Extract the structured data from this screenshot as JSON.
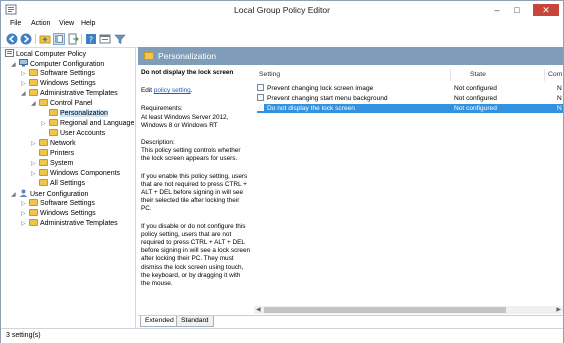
{
  "window": {
    "title": "Local Group Policy Editor",
    "controls": [
      "–",
      "□",
      "✕"
    ]
  },
  "menu": [
    "File",
    "Action",
    "View",
    "Help"
  ],
  "toolbar": [
    "back-icon",
    "forward-icon",
    "up-folder-icon",
    "show-hide-tree-icon",
    "export-list-icon",
    "help-icon",
    "properties-icon",
    "filter-icon"
  ],
  "tree": [
    {
      "label": "Local Computer Policy",
      "level": 0,
      "arrow": "",
      "icon": "computer-policy"
    },
    {
      "label": "Computer Configuration",
      "level": 1,
      "arrow": "◢",
      "icon": "computer"
    },
    {
      "label": "Software Settings",
      "level": 2,
      "arrow": "▷",
      "icon": "folder"
    },
    {
      "label": "Windows Settings",
      "level": 2,
      "arrow": "▷",
      "icon": "folder"
    },
    {
      "label": "Administrative Templates",
      "level": 2,
      "arrow": "◢",
      "icon": "folder"
    },
    {
      "label": "Control Panel",
      "level": 3,
      "arrow": "◢",
      "icon": "folder"
    },
    {
      "label": "Personalization",
      "level": 4,
      "arrow": "",
      "icon": "folder",
      "selected": true
    },
    {
      "label": "Regional and Language",
      "level": 4,
      "arrow": "▷",
      "icon": "folder"
    },
    {
      "label": "User Accounts",
      "level": 4,
      "arrow": "",
      "icon": "folder"
    },
    {
      "label": "Network",
      "level": 3,
      "arrow": "▷",
      "icon": "folder"
    },
    {
      "label": "Printers",
      "level": 3,
      "arrow": "",
      "icon": "folder"
    },
    {
      "label": "System",
      "level": 3,
      "arrow": "▷",
      "icon": "folder"
    },
    {
      "label": "Windows Components",
      "level": 3,
      "arrow": "▷",
      "icon": "folder"
    },
    {
      "label": "All Settings",
      "level": 3,
      "arrow": "",
      "icon": "folder"
    },
    {
      "label": "User Configuration",
      "level": 1,
      "arrow": "◢",
      "icon": "user"
    },
    {
      "label": "Software Settings",
      "level": 2,
      "arrow": "▷",
      "icon": "folder"
    },
    {
      "label": "Windows Settings",
      "level": 2,
      "arrow": "▷",
      "icon": "folder"
    },
    {
      "label": "Administrative Templates",
      "level": 2,
      "arrow": "▷",
      "icon": "folder"
    }
  ],
  "pane": {
    "header": "Personalization",
    "description": {
      "title": "Do not display the lock screen",
      "edit_prefix": "Edit ",
      "edit_link": "policy setting",
      "edit_suffix": ".",
      "req_label": "Requirements:",
      "req_text": "At least Windows Server 2012, Windows 8 or Windows RT",
      "desc_label": "Description:",
      "desc_text": "This policy setting controls whether the lock screen appears for users.",
      "para1": "If you enable this policy setting, users that are not required to press CTRL + ALT + DEL before signing in will see their selected tile after  locking their PC.",
      "para2": "If you disable or do not configure this policy setting, users that are not required to press CTRL + ALT + DEL before signing in will see a lock screen after locking their PC. They must dismiss the lock screen using touch, the keyboard, or by dragging it with the mouse."
    },
    "columns": {
      "setting": "Setting",
      "state": "State",
      "comment": "Com"
    },
    "rows": [
      {
        "setting": "Prevent changing lock screen image",
        "state": "Not configured",
        "comment": "N"
      },
      {
        "setting": "Prevent changing start menu background",
        "state": "Not configured",
        "comment": "N"
      },
      {
        "setting": "Do not display the lock screen",
        "state": "Not configured",
        "comment": "N",
        "selected": true
      }
    ],
    "tabs": [
      "Extended",
      "Standard"
    ]
  },
  "status": "3 setting(s)",
  "colors": {
    "header_bg": "#7f9db8",
    "selection": "#3392e0",
    "folder": "#f0c54a",
    "link": "#1a5dc8"
  }
}
